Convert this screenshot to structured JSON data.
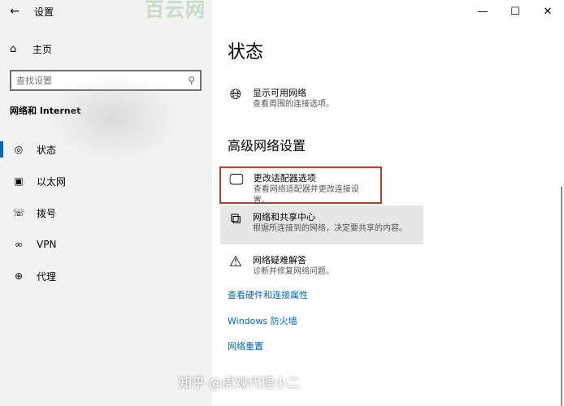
{
  "window": {
    "title": "设置",
    "controls": [
      "—",
      "☐",
      "✕"
    ]
  },
  "watermark_top": "百云网",
  "sidebar": {
    "back_icon": "←",
    "home": {
      "icon": "home-icon",
      "label": "主页"
    },
    "search": {
      "placeholder": "查找设置",
      "icon": "search-icon"
    },
    "section_title": "网络和 Internet",
    "items": [
      {
        "label": "状态",
        "icon": "status-icon",
        "active": true
      },
      {
        "label": "以太网",
        "icon": "ethernet-icon",
        "active": false
      },
      {
        "label": "拨号",
        "icon": "dialup-icon",
        "active": false
      },
      {
        "label": "VPN",
        "icon": "vpn-icon",
        "active": false
      },
      {
        "label": "代理",
        "icon": "proxy-icon",
        "active": false
      }
    ]
  },
  "main": {
    "page_title": "状态",
    "show_networks": {
      "title": "显示可用网络",
      "desc": "查看周围的连接选项。"
    },
    "advanced_title": "高级网络设置",
    "options": [
      {
        "title": "更改适配器选项",
        "desc": "查看网络适配器并更改连接设置。",
        "icon": "adapter-icon"
      },
      {
        "title": "网络和共享中心",
        "desc": "根据所连接到的网络，决定要共享的内容。",
        "icon": "sharing-center-icon"
      },
      {
        "title": "网络疑难解答",
        "desc": "诊断并修复网络问题。",
        "icon": "troubleshoot-icon"
      }
    ],
    "links": [
      "查看硬件和连接属性",
      "Windows 防火墙",
      "网络重置"
    ]
  },
  "watermark_bottom": "知乎 @虎观代理小二",
  "colors": {
    "accent": "#0067b8",
    "highlight_border": "#c0392b",
    "sidebar_bg": "#f2f2f2"
  }
}
